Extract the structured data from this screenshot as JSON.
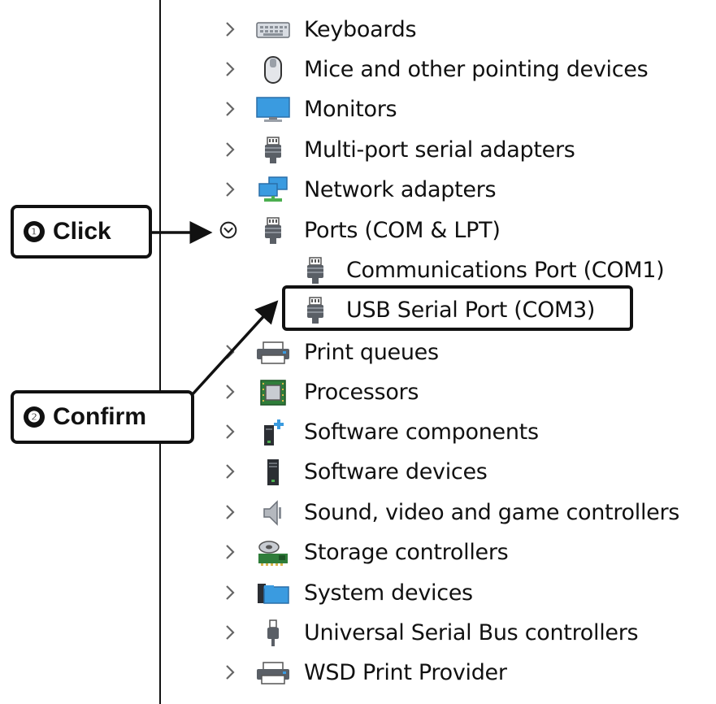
{
  "tree": {
    "items": [
      {
        "label": "Keyboards",
        "icon": "keyboard-icon",
        "expanded": false
      },
      {
        "label": "Mice and other pointing devices",
        "icon": "mouse-icon",
        "expanded": false
      },
      {
        "label": "Monitors",
        "icon": "monitor-icon",
        "expanded": false
      },
      {
        "label": "Multi-port serial adapters",
        "icon": "port-plug-icon",
        "expanded": false
      },
      {
        "label": "Network adapters",
        "icon": "network-adapter-icon",
        "expanded": false
      },
      {
        "label": "Ports (COM & LPT)",
        "icon": "port-plug-icon",
        "expanded": true,
        "children": [
          {
            "label": "Communications Port (COM1)",
            "icon": "port-plug-icon"
          },
          {
            "label": "USB Serial Port (COM3)",
            "icon": "port-plug-icon"
          }
        ]
      },
      {
        "label": "Print queues",
        "icon": "printer-icon",
        "expanded": false
      },
      {
        "label": "Processors",
        "icon": "processor-chip-icon",
        "expanded": false
      },
      {
        "label": "Software components",
        "icon": "software-component-icon",
        "expanded": false
      },
      {
        "label": "Software devices",
        "icon": "software-device-icon",
        "expanded": false
      },
      {
        "label": "Sound, video and game controllers",
        "icon": "speaker-icon",
        "expanded": false
      },
      {
        "label": "Storage controllers",
        "icon": "storage-controller-icon",
        "expanded": false
      },
      {
        "label": "System devices",
        "icon": "system-folder-icon",
        "expanded": false
      },
      {
        "label": "Universal Serial Bus controllers",
        "icon": "usb-plug-icon",
        "expanded": false
      },
      {
        "label": "WSD Print Provider",
        "icon": "printer-icon",
        "expanded": false
      }
    ]
  },
  "callouts": {
    "click": {
      "number": "❶",
      "label": "Click"
    },
    "confirm": {
      "number": "❷",
      "label": "Confirm"
    }
  },
  "colors": {
    "text": "#111111",
    "chevron": "#666666",
    "monitor_blue": "#3a9be0",
    "chip_green": "#2f7d3a"
  }
}
